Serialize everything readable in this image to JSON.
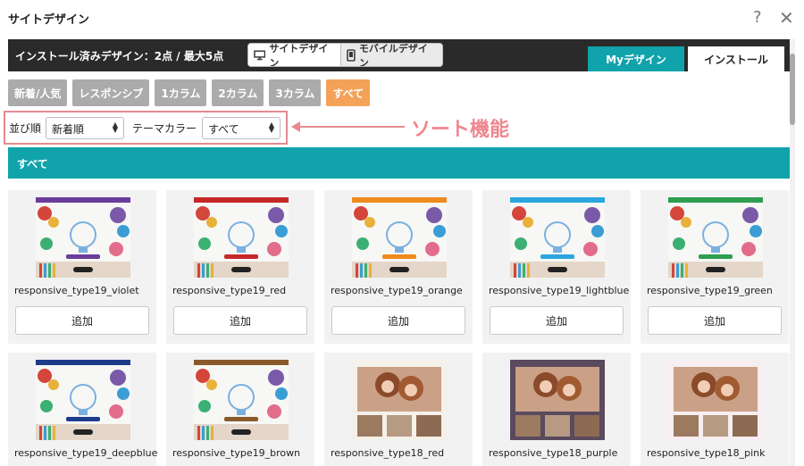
{
  "dialog": {
    "title": "サイトデザイン",
    "help": "?",
    "close": "✕"
  },
  "bar": {
    "install_count": "インストール済みデザイン：2点 / 最大5点",
    "device_site": "サイトデザイン",
    "device_mobile": "モバイルデザイン",
    "tab_my": "Myデザイン",
    "tab_install": "インストール"
  },
  "filters": [
    {
      "label": "新着/人気",
      "active": false
    },
    {
      "label": "レスポンシブ",
      "active": false
    },
    {
      "label": "1カラム",
      "active": false
    },
    {
      "label": "2カラム",
      "active": false
    },
    {
      "label": "3カラム",
      "active": false
    },
    {
      "label": "すべて",
      "active": true
    }
  ],
  "sort": {
    "order_label": "並び順",
    "order_value": "新着順",
    "color_label": "テーマカラー",
    "color_value": "すべて"
  },
  "callout": "ソート機能",
  "section_title": "すべて",
  "add_label": "追加",
  "designs": [
    {
      "name": "responsive_type19_violet",
      "accent": "#6a3d9a",
      "style": "bulb"
    },
    {
      "name": "responsive_type19_red",
      "accent": "#c62828",
      "style": "bulb"
    },
    {
      "name": "responsive_type19_orange",
      "accent": "#ef8a1e",
      "style": "bulb"
    },
    {
      "name": "responsive_type19_lightblue",
      "accent": "#2ba6e0",
      "style": "bulb"
    },
    {
      "name": "responsive_type19_green",
      "accent": "#2e9e4f",
      "style": "bulb"
    },
    {
      "name": "responsive_type19_deepblue",
      "accent": "#1e3a8a",
      "style": "bulb"
    },
    {
      "name": "responsive_type19_brown",
      "accent": "#8a5a2b",
      "style": "bulb"
    },
    {
      "name": "responsive_type18_red",
      "accent": "#f4f0ea",
      "style": "photo"
    },
    {
      "name": "responsive_type18_purple",
      "accent": "#5a4a5e",
      "style": "photo"
    },
    {
      "name": "responsive_type18_pink",
      "accent": "#f6eef0",
      "style": "photo"
    }
  ]
}
